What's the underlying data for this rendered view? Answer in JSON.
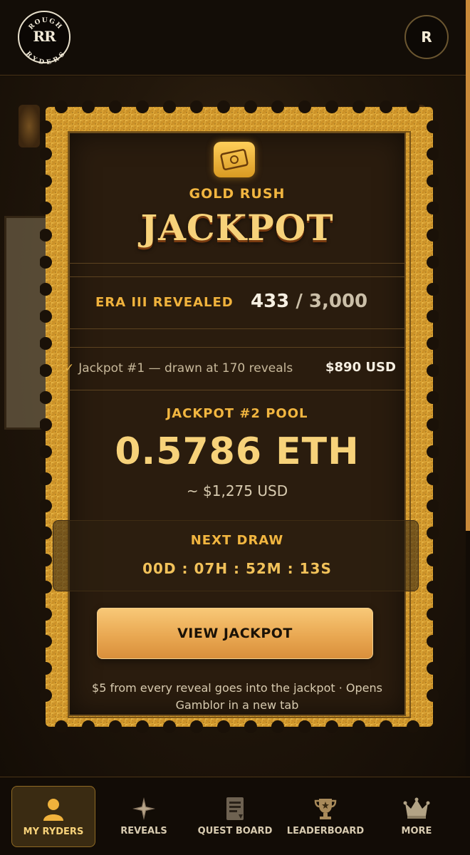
{
  "header": {
    "logo_top": "ROUGH",
    "logo_mono": "RR",
    "logo_bottom": "RYDERS",
    "avatar_initial": "R"
  },
  "jackpot": {
    "kicker": "GOLD RUSH",
    "title": "JACKPOT",
    "era_label": "ERA III REVEALED",
    "revealed": "433",
    "total": "/ 3,000",
    "past_draw_text": "Jackpot #1 — drawn at 170 reveals",
    "past_draw_amount": "$890 USD",
    "pool_label": "JACKPOT #2 POOL",
    "pool_amount": "0.5786 ETH",
    "pool_usd": "~ $1,275 USD",
    "next_draw_label": "NEXT DRAW",
    "countdown": "00D : 07H : 52M : 13S",
    "cta": "VIEW JACKPOT",
    "footnote": "$5 from every reveal goes into the jackpot · Opens Gamblor in a new tab"
  },
  "nav": {
    "items": [
      {
        "label": "MY RYDERS",
        "icon": "user-icon",
        "active": true
      },
      {
        "label": "REVEALS",
        "icon": "compass-star-icon",
        "active": false
      },
      {
        "label": "QUEST BOARD",
        "icon": "document-icon",
        "active": false
      },
      {
        "label": "LEADERBOARD",
        "icon": "trophy-icon",
        "active": false
      },
      {
        "label": "MORE",
        "icon": "crown-icon",
        "active": false
      }
    ]
  },
  "colors": {
    "accent_gold": "#f7d27a",
    "label_orange": "#f0b23c",
    "background": "#120c06",
    "ticket_border": "#d9a433"
  }
}
